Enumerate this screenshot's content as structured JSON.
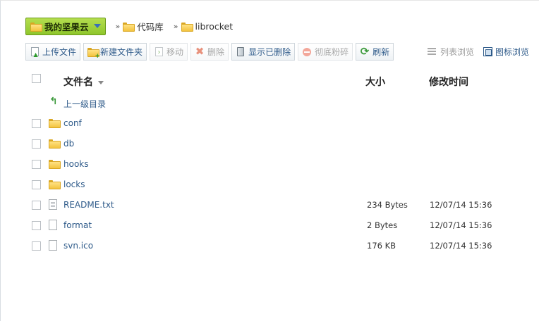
{
  "breadcrumb": {
    "home_label": "我的坚果云",
    "separator": "»",
    "crumbs": [
      "代码库",
      "librocket"
    ]
  },
  "toolbar": {
    "upload": "上传文件",
    "new_folder": "新建文件夹",
    "move": "移动",
    "delete": "删除",
    "show_deleted": "显示已删除",
    "shred": "彻底粉碎",
    "refresh": "刷新"
  },
  "view_modes": {
    "list": "列表浏览",
    "icon": "图标浏览"
  },
  "table": {
    "headers": {
      "name": "文件名",
      "size": "大小",
      "modified": "修改时间"
    },
    "parent_dir": "上一级目录",
    "rows": [
      {
        "name": "conf",
        "type": "folder",
        "size": "",
        "modified": ""
      },
      {
        "name": "db",
        "type": "folder",
        "size": "",
        "modified": ""
      },
      {
        "name": "hooks",
        "type": "folder",
        "size": "",
        "modified": ""
      },
      {
        "name": "locks",
        "type": "folder",
        "size": "",
        "modified": ""
      },
      {
        "name": "README.txt",
        "type": "text-file",
        "size": "234 Bytes",
        "modified": "12/07/14 15:36"
      },
      {
        "name": "format",
        "type": "file",
        "size": "2 Bytes",
        "modified": "12/07/14 15:36"
      },
      {
        "name": "svn.ico",
        "type": "file",
        "size": "176 KB",
        "modified": "12/07/14 15:36"
      }
    ]
  },
  "colors": {
    "home_button": "#9fd13a",
    "link": "#2f5b8a",
    "folder": "#f3c33f"
  }
}
